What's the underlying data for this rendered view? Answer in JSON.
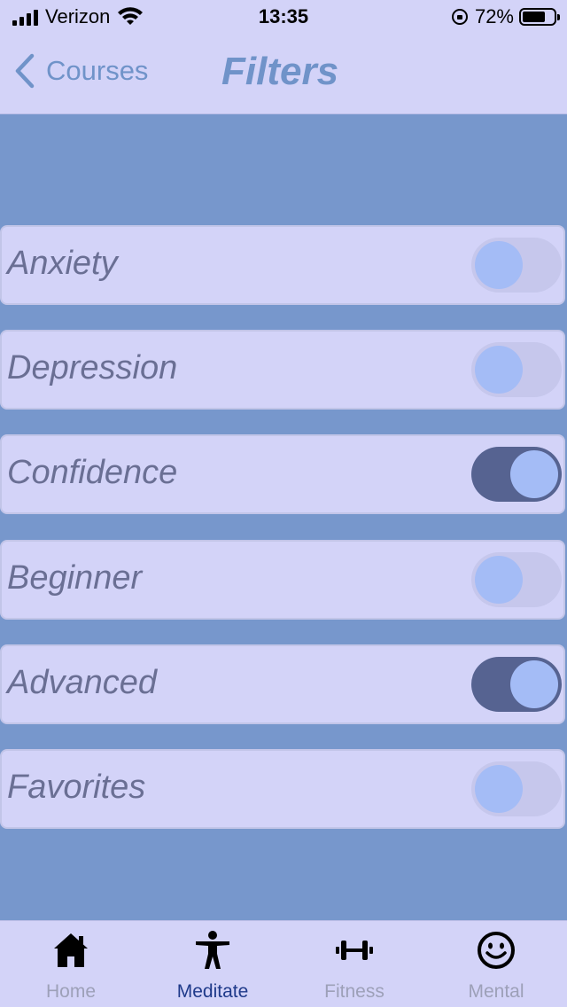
{
  "status_bar": {
    "carrier": "Verizon",
    "time": "13:35",
    "battery": "72%"
  },
  "nav": {
    "back_label": "Courses",
    "title": "Filters"
  },
  "filters": [
    {
      "label": "Anxiety",
      "on": false
    },
    {
      "label": "Depression",
      "on": false
    },
    {
      "label": "Confidence",
      "on": true
    },
    {
      "label": "Beginner",
      "on": false
    },
    {
      "label": "Advanced",
      "on": true
    },
    {
      "label": "Favorites",
      "on": false
    }
  ],
  "tabs": [
    {
      "label": "Home",
      "icon": "home-icon",
      "active": false
    },
    {
      "label": "Meditate",
      "icon": "person-icon",
      "active": true
    },
    {
      "label": "Fitness",
      "icon": "dumbbell-icon",
      "active": false
    },
    {
      "label": "Mental",
      "icon": "smiley-icon",
      "active": false
    }
  ],
  "colors": {
    "page_background": "#7797cc",
    "bar_background": "#d3d3f8",
    "accent": "#7093c9",
    "toggle_on": "#566391",
    "toggle_off": "#c6c7ec",
    "knob": "#a4bcf6",
    "active_tab": "#1f3a8a"
  }
}
